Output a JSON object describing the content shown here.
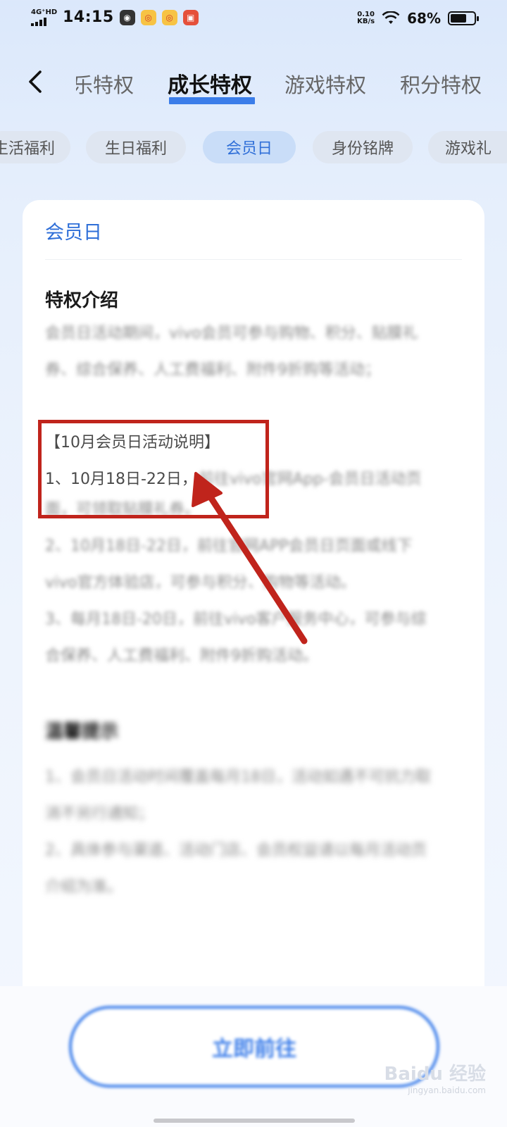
{
  "status_bar": {
    "network": "4G⁺HD",
    "time": "14:15",
    "speed_value": "0.10",
    "speed_unit": "KB/s",
    "battery": "68%"
  },
  "nav": {
    "back_icon": "chevron-left-icon",
    "tabs": [
      "乐特权",
      "成长特权",
      "游戏特权",
      "积分特权"
    ],
    "active_tab": "成长特权"
  },
  "chips": [
    "生活福利",
    "生日福利",
    "会员日",
    "身份铭牌",
    "游戏礼"
  ],
  "active_chip": "会员日",
  "card": {
    "title": "会员日",
    "intro_title": "特权介绍",
    "intro_lines": [
      "会员日活动期间，vivo会员可参与购物、积分、贴膜礼",
      "券、综合保养、人工费福利、附件9折购等活动；"
    ],
    "notice_heading": "【10月会员日活动说明】",
    "notice_line1_clear": "1、10月18日-22日，",
    "notice_line1_rest": "前往vivo官网App-会员日活动页",
    "notice_lines": [
      "面，可领取贴膜礼券。",
      "2、10月18日-22日，前往官网APP会员日页面或线下",
      "vivo官方体验店，可参与积分、购物等活动。",
      "3、每月18日-20日，前往vivo客户服务中心，可参与综",
      "合保养、人工费福利、附件9折购活动。"
    ],
    "tips_title": "温馨提示",
    "tips_lines": [
      "1、会员日活动时间覆盖每月18日，活动如遇不可抗力取",
      "消不另行通知；",
      "2、具体参与渠道、活动门店、会员权益请以每月活动页",
      "介绍为准。"
    ]
  },
  "button": {
    "label": "立即前往"
  },
  "watermark": {
    "logo": "Baidu 经验",
    "url": "jingyan.baidu.com"
  },
  "colors": {
    "accent": "#3b7de9",
    "annotation": "#c0241c"
  }
}
